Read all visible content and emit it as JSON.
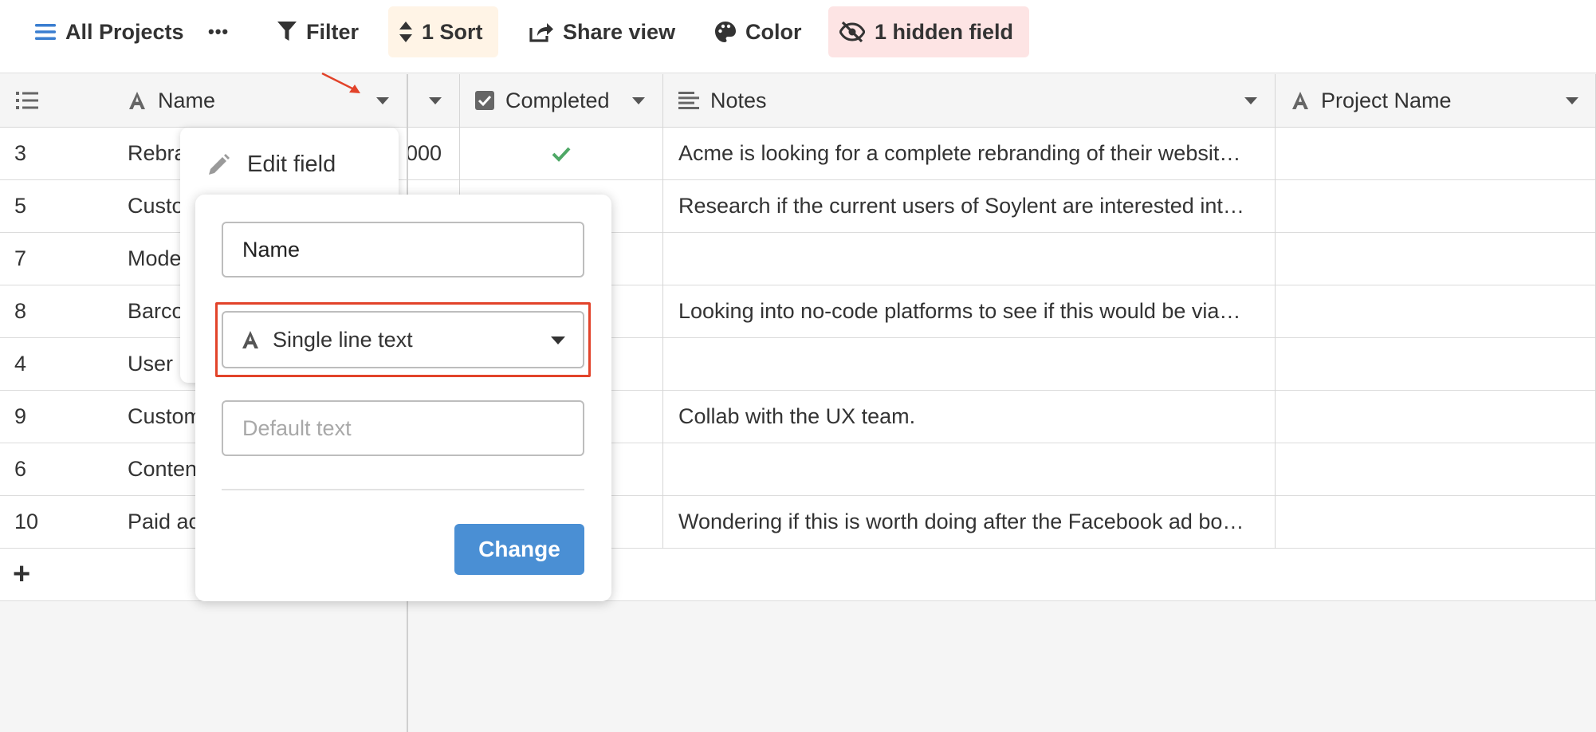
{
  "toolbar": {
    "view_name": "All Projects",
    "more": "•••",
    "filter": "Filter",
    "sort": "1 Sort",
    "share": "Share view",
    "color": "Color",
    "hidden": "1 hidden field"
  },
  "columns": {
    "name": "Name",
    "completed": "Completed",
    "notes": "Notes",
    "project_name": "Project Name"
  },
  "rows": [
    {
      "id": "3",
      "name": "Rebra",
      "budget": "000",
      "completed": true,
      "notes": "Acme is looking for a complete rebranding of their websit…"
    },
    {
      "id": "5",
      "name": "Custo",
      "budget": "",
      "completed": false,
      "notes": "Research if the current users of Soylent are interested int…"
    },
    {
      "id": "7",
      "name": "Mode",
      "budget": "",
      "completed": false,
      "notes": ""
    },
    {
      "id": "8",
      "name": "Barco",
      "budget": "",
      "completed": false,
      "notes": "Looking into no-code platforms to see if this would be via…"
    },
    {
      "id": "4",
      "name": "User",
      "budget": "",
      "completed": false,
      "notes": ""
    },
    {
      "id": "9",
      "name": "Custom",
      "budget": "",
      "completed": false,
      "notes": "Collab with the UX team."
    },
    {
      "id": "6",
      "name": "Conten",
      "budget": "",
      "completed": false,
      "notes": ""
    },
    {
      "id": "10",
      "name": "Paid ac",
      "budget": "",
      "completed": false,
      "notes": "Wondering if this is worth doing after the Facebook ad bo…"
    }
  ],
  "add_row": "+",
  "field_menu": {
    "edit_field": "Edit field"
  },
  "edit_popover": {
    "field_name_value": "Name",
    "field_type": "Single line text",
    "default_placeholder": "Default text",
    "change_button": "Change"
  },
  "colors": {
    "accent": "#4a8fd4",
    "annotation": "#e2432a",
    "sort_bg": "#fff4e6",
    "hidden_bg": "#fde4e4",
    "check": "#4ea866"
  }
}
